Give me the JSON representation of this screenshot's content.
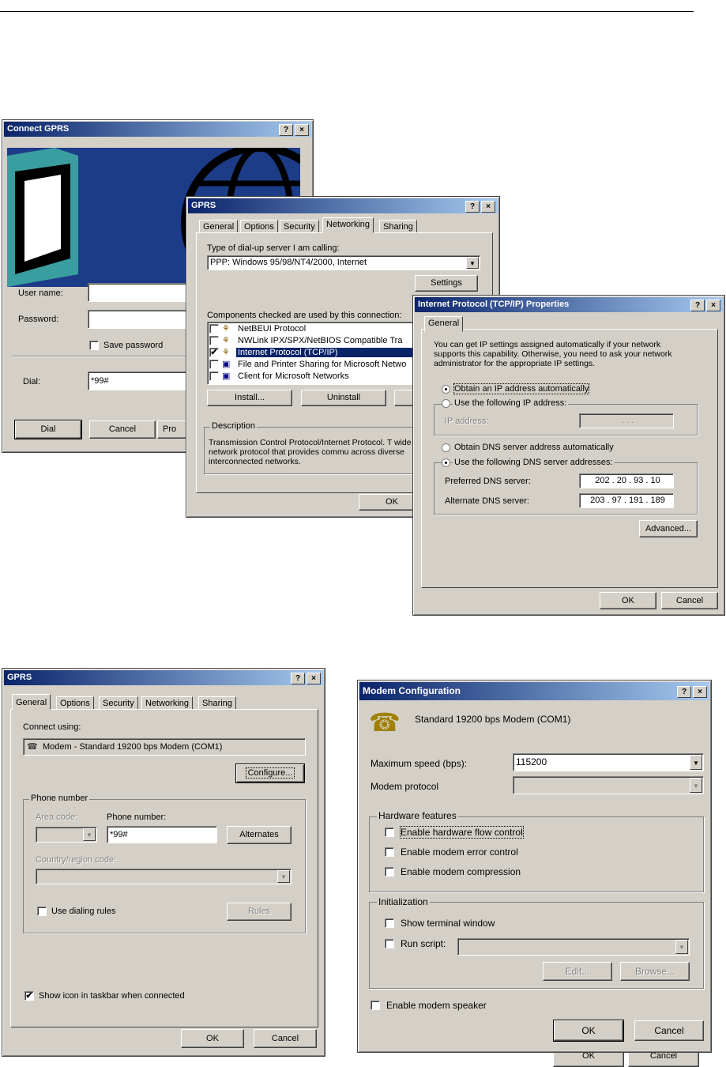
{
  "connect": {
    "title": "Connect GPRS",
    "user_label": "User name:",
    "password_label": "Password:",
    "save_password": "Save password",
    "dial_label": "Dial:",
    "dial_value": "*99#",
    "btn_dial": "Dial",
    "btn_cancel": "Cancel",
    "btn_prop": "Pro"
  },
  "gprs_net": {
    "title": "GPRS",
    "tabs": [
      "General",
      "Options",
      "Security",
      "Networking",
      "Sharing"
    ],
    "server_label": "Type of dial-up server I am calling:",
    "server_value": "PPP: Windows 95/98/NT4/2000, Internet",
    "settings": "Settings",
    "components_label": "Components checked are used by this connection:",
    "components": [
      "NetBEUI Protocol",
      "NWLink IPX/SPX/NetBIOS Compatible Tra",
      "Internet Protocol (TCP/IP)",
      "File and Printer Sharing for Microsoft Netwo",
      "Client for Microsoft Networks"
    ],
    "install": "Install...",
    "uninstall": "Uninstall",
    "description_label": "Description",
    "description": "Transmission Control Protocol/Internet Protocol. T wide area network protocol that provides commu across diverse interconnected networks.",
    "ok": "OK"
  },
  "tcpip": {
    "title": "Internet Protocol (TCP/IP) Properties",
    "tab": "General",
    "intro": "You can get IP settings assigned automatically if your network supports this capability. Otherwise, you need to ask your network administrator for the appropriate IP settings.",
    "obtain_ip": "Obtain an IP address automatically",
    "use_ip": "Use the following IP address:",
    "ip_label": "IP address:",
    "ip_value": ". . .",
    "obtain_dns": "Obtain DNS server address automatically",
    "use_dns": "Use the following DNS server addresses:",
    "pref_label": "Preferred DNS server:",
    "pref_value": "202 . 20 . 93 . 10",
    "alt_label": "Alternate DNS server:",
    "alt_value": "203 . 97 . 191 . 189",
    "advanced": "Advanced...",
    "ok": "OK",
    "cancel": "Cancel"
  },
  "gprs_gen": {
    "title": "GPRS",
    "tabs": [
      "General",
      "Options",
      "Security",
      "Networking",
      "Sharing"
    ],
    "connect_using": "Connect using:",
    "modem": "Modem - Standard 19200 bps Modem (COM1)",
    "configure": "Configure...",
    "phone_group": "Phone number",
    "area_label": "Area code:",
    "phone_label": "Phone number:",
    "phone_value": "*99#",
    "alternates": "Alternates",
    "country_label": "Country/region code:",
    "use_rules": "Use dialing rules",
    "rules": "Rules",
    "show_icon": "Show icon in taskbar when connected",
    "ok": "OK",
    "cancel": "Cancel"
  },
  "modem": {
    "title": "Modem Configuration",
    "name": "Standard 19200 bps Modem (COM1)",
    "max_speed_label": "Maximum speed (bps):",
    "max_speed": "115200",
    "protocol_label": "Modem protocol",
    "hw_group": "Hardware features",
    "hw_flow": "Enable hardware flow control",
    "err_ctrl": "Enable modem error control",
    "compress": "Enable modem compression",
    "init_group": "Initialization",
    "show_term": "Show terminal window",
    "run_script": "Run script:",
    "edit": "Edit...",
    "browse": "Browse...",
    "speaker": "Enable modem speaker",
    "ok": "OK",
    "cancel": "Cancel"
  },
  "behind": {
    "ok": "OK",
    "cancel": "Cancel"
  },
  "titlebar_buttons": {
    "help": "?",
    "close": "×"
  },
  "check_mark": "✔",
  "dropdown_arrow": "▼"
}
